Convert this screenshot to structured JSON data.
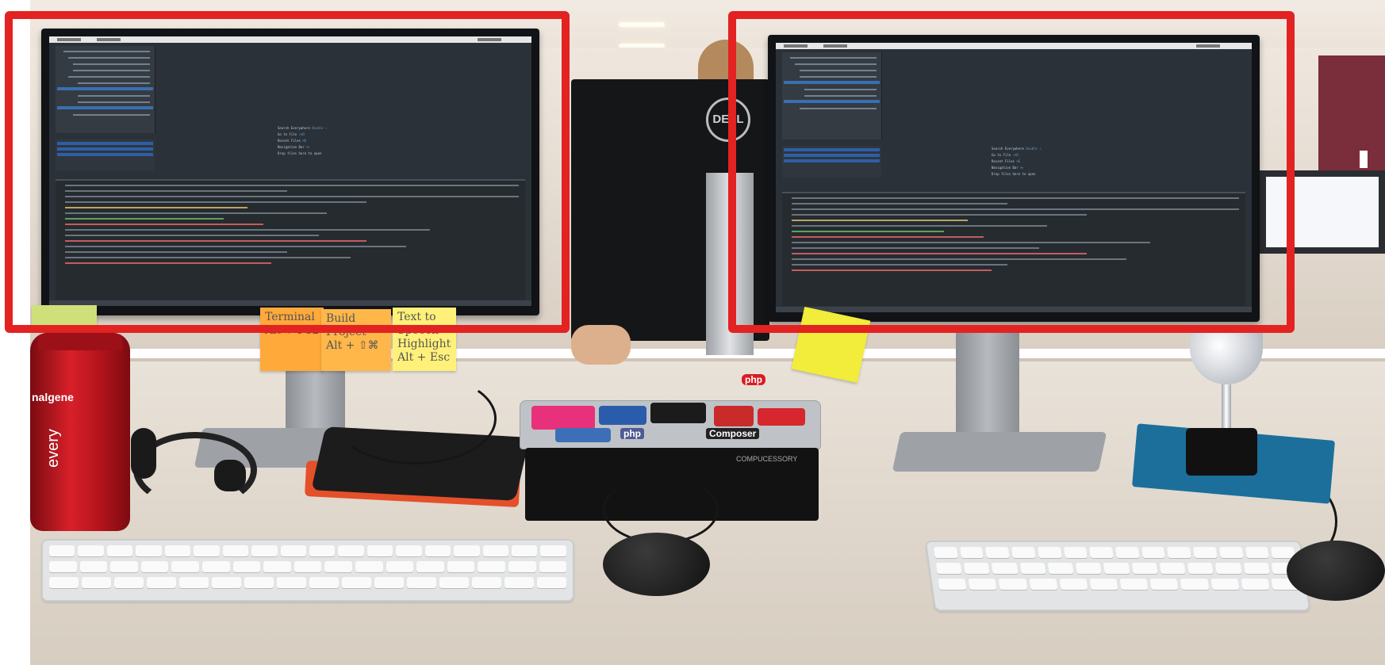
{
  "scene": {
    "description_tags": [
      "office-desk",
      "dual-monitor-setup"
    ],
    "highlight_color": "#e32222"
  },
  "ide": {
    "hints": [
      {
        "label": "Search Everywhere",
        "key": "Double ⇧"
      },
      {
        "label": "Go to File",
        "key": "⇧⌘O"
      },
      {
        "label": "Recent Files",
        "key": "⌘E"
      },
      {
        "label": "Navigation Bar",
        "key": "⌘↑"
      },
      {
        "label": "Drop files here to open",
        "key": ""
      }
    ]
  },
  "postits": {
    "left1": "Terminal\nAlt + F12",
    "left2": "Build Project\nAlt + ⇧⌘",
    "left3": "Text to Speech\nHighlight\nAlt + Esc"
  },
  "stickers": {
    "php": "php",
    "composer": "Composer",
    "elephant": "php"
  },
  "bottle": {
    "brand": "nalgene",
    "slogan": "every"
  },
  "minipc": {
    "brand": "COMPUCESSORY"
  },
  "dell": {
    "logo": "DELL"
  }
}
